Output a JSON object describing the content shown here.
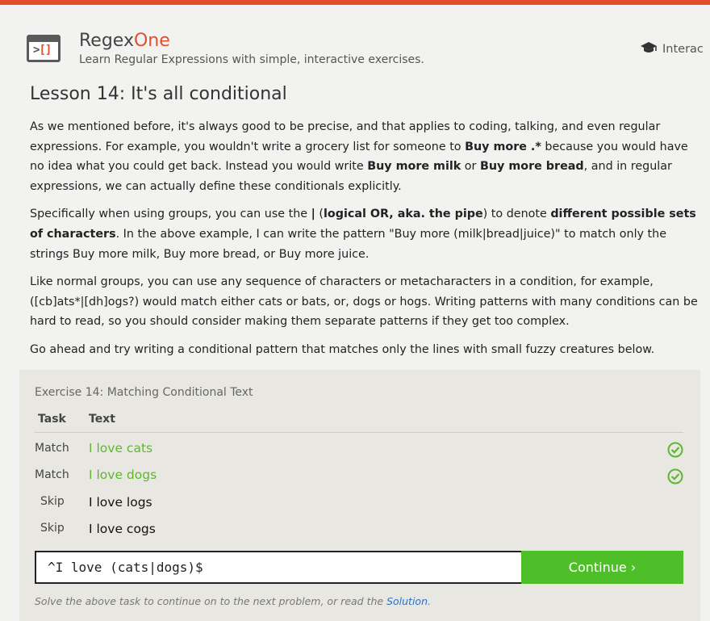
{
  "header": {
    "logo_left": ">",
    "logo_right": "[]",
    "brand_part1": "Regex",
    "brand_part2": "One",
    "tagline": "Learn Regular Expressions with simple, interactive exercises.",
    "nav_label": "Interac",
    "nav_icon": "graduation-cap-icon",
    "accent_color": "#e34e2f"
  },
  "lesson": {
    "title": "Lesson 14: It's all conditional",
    "p1": [
      "As we mentioned before, it's always good to be precise, and that applies to coding, talking, and even regular expressions. For example, you wouldn't write a grocery list for someone to ",
      "Buy more .*",
      " because you would have no idea what you could get back. Instead you would write ",
      "Buy more milk",
      " or ",
      "Buy more bread",
      ", and in regular expressions, we can actually define these conditionals explicitly."
    ],
    "p2": [
      "Specifically when using groups, you can use the ",
      "|",
      " (",
      "logical OR, aka. the pipe",
      ") to denote ",
      "different possible sets of characters",
      ". In the above example, I can write the pattern \"Buy more (milk|bread|juice)\" to match only the strings Buy more milk, Buy more bread, or Buy more juice."
    ],
    "p3": "Like normal groups, you can use any sequence of characters or metacharacters in a condition, for example, ([cb]ats*|[dh]ogs?) would match either cats or bats, or, dogs or hogs. Writing patterns with many conditions can be hard to read, so you should consider making them separate patterns if they get too complex.",
    "p4": "Go ahead and try writing a conditional pattern that matches only the lines with small fuzzy creatures below."
  },
  "exercise": {
    "title": "Exercise 14: Matching Conditional Text",
    "col_task": "Task",
    "col_text": "Text",
    "rows": [
      {
        "task": "Match",
        "text": "I love cats"
      },
      {
        "task": "Match",
        "text": "I love dogs"
      },
      {
        "task": "Skip",
        "text": "I love logs"
      },
      {
        "task": "Skip",
        "text": "I love cogs"
      }
    ],
    "input_value": "^I love (cats|dogs)$",
    "continue_label": "Continue ›",
    "hint_text": "Solve the above task to continue on to the next problem, or read the ",
    "hint_link": "Solution",
    "hint_end": ".",
    "match_color": "#5fb630",
    "button_color": "#4fbf29"
  }
}
